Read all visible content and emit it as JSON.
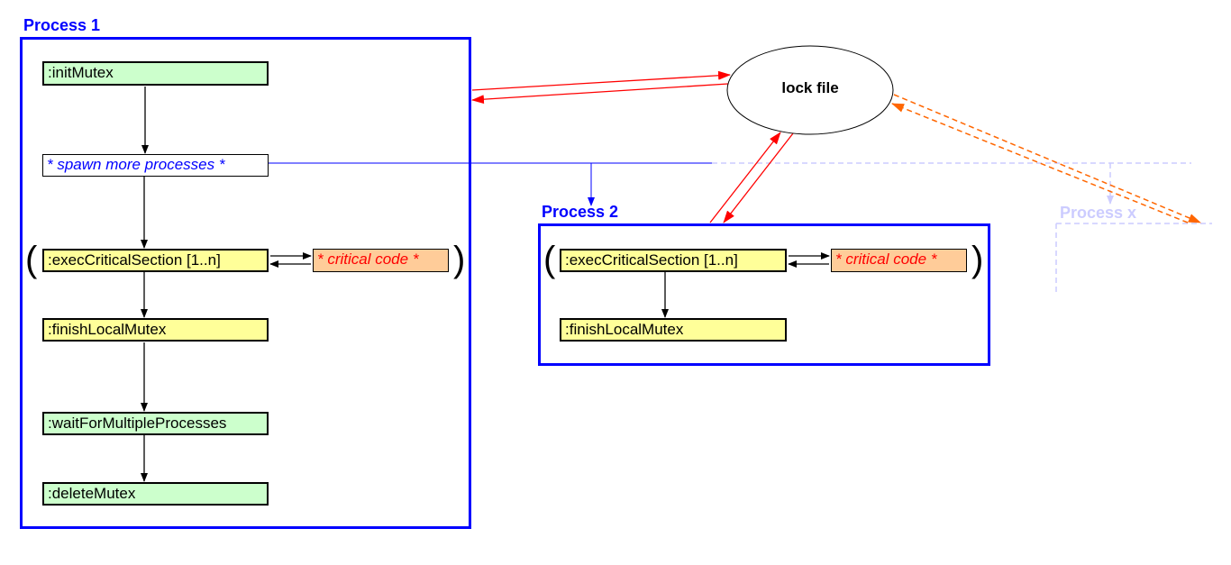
{
  "process1": {
    "label": "Process 1",
    "nodes": {
      "init": ":initMutex",
      "spawn": "* spawn more processes *",
      "exec": ":execCriticalSection [1..n]",
      "critical": "* critical code *",
      "finish": ":finishLocalMutex",
      "wait": ":waitForMultipleProcesses",
      "delete": ":deleteMutex"
    }
  },
  "process2": {
    "label": "Process 2",
    "nodes": {
      "exec": ":execCriticalSection [1..n]",
      "critical": "* critical code *",
      "finish": ":finishLocalMutex"
    }
  },
  "processx": {
    "label": "Process x"
  },
  "lockfile": {
    "label": "lock file"
  },
  "paren_open": "(",
  "paren_close": ")",
  "colors": {
    "process": "#0000ff",
    "lock_link": "#ff0000",
    "processx_link": "#ff6600",
    "faded": "#ccccff",
    "init_nodes": "#ccffcc",
    "critical_nodes": "#ffff99",
    "critical_code": "#ffcc99"
  }
}
